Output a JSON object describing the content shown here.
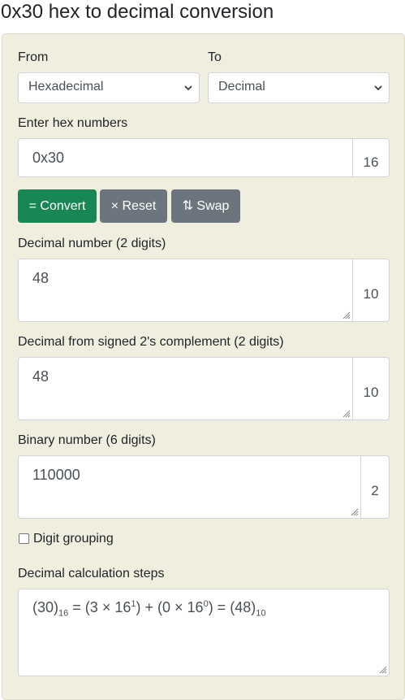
{
  "page": {
    "title": "0x30 hex to decimal conversion"
  },
  "form": {
    "from_label": "From",
    "to_label": "To",
    "from_value": "Hexadecimal",
    "to_value": "Decimal",
    "input_label": "Enter hex numbers",
    "input_value": "0x30",
    "input_base": "16"
  },
  "buttons": {
    "convert": "= Convert",
    "reset": "× Reset",
    "swap": "⇅ Swap"
  },
  "results": {
    "decimal_label": "Decimal number (2 digits)",
    "decimal_value": "48",
    "decimal_base": "10",
    "signed_label": "Decimal from signed 2's complement (2 digits)",
    "signed_value": "48",
    "signed_base": "10",
    "binary_label": "Binary number (6 digits)",
    "binary_value": "110000",
    "binary_base": "2"
  },
  "options": {
    "digit_grouping_label": "Digit grouping",
    "digit_grouping_checked": false
  },
  "steps": {
    "label": "Decimal calculation steps",
    "hex_digits": "30",
    "from_base": "16",
    "term1_digit": "3",
    "term1_base": "16",
    "term1_exp": "1",
    "term2_digit": "0",
    "term2_base": "16",
    "term2_exp": "0",
    "result": "48",
    "to_base": "10"
  },
  "colors": {
    "panel": "#efeedf",
    "convert": "#198754",
    "secondary": "#6c757d"
  }
}
